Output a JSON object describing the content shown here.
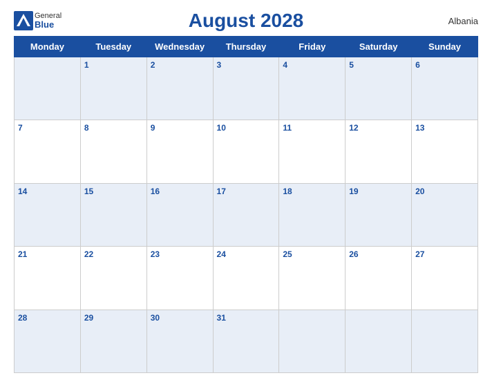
{
  "header": {
    "title": "August 2028",
    "country": "Albania",
    "logo": {
      "general": "General",
      "blue": "Blue"
    }
  },
  "weekdays": [
    "Monday",
    "Tuesday",
    "Wednesday",
    "Thursday",
    "Friday",
    "Saturday",
    "Sunday"
  ],
  "weeks": [
    [
      "",
      "1",
      "2",
      "3",
      "4",
      "5",
      "6"
    ],
    [
      "7",
      "8",
      "9",
      "10",
      "11",
      "12",
      "13"
    ],
    [
      "14",
      "15",
      "16",
      "17",
      "18",
      "19",
      "20"
    ],
    [
      "21",
      "22",
      "23",
      "24",
      "25",
      "26",
      "27"
    ],
    [
      "28",
      "29",
      "30",
      "31",
      "",
      "",
      ""
    ]
  ]
}
